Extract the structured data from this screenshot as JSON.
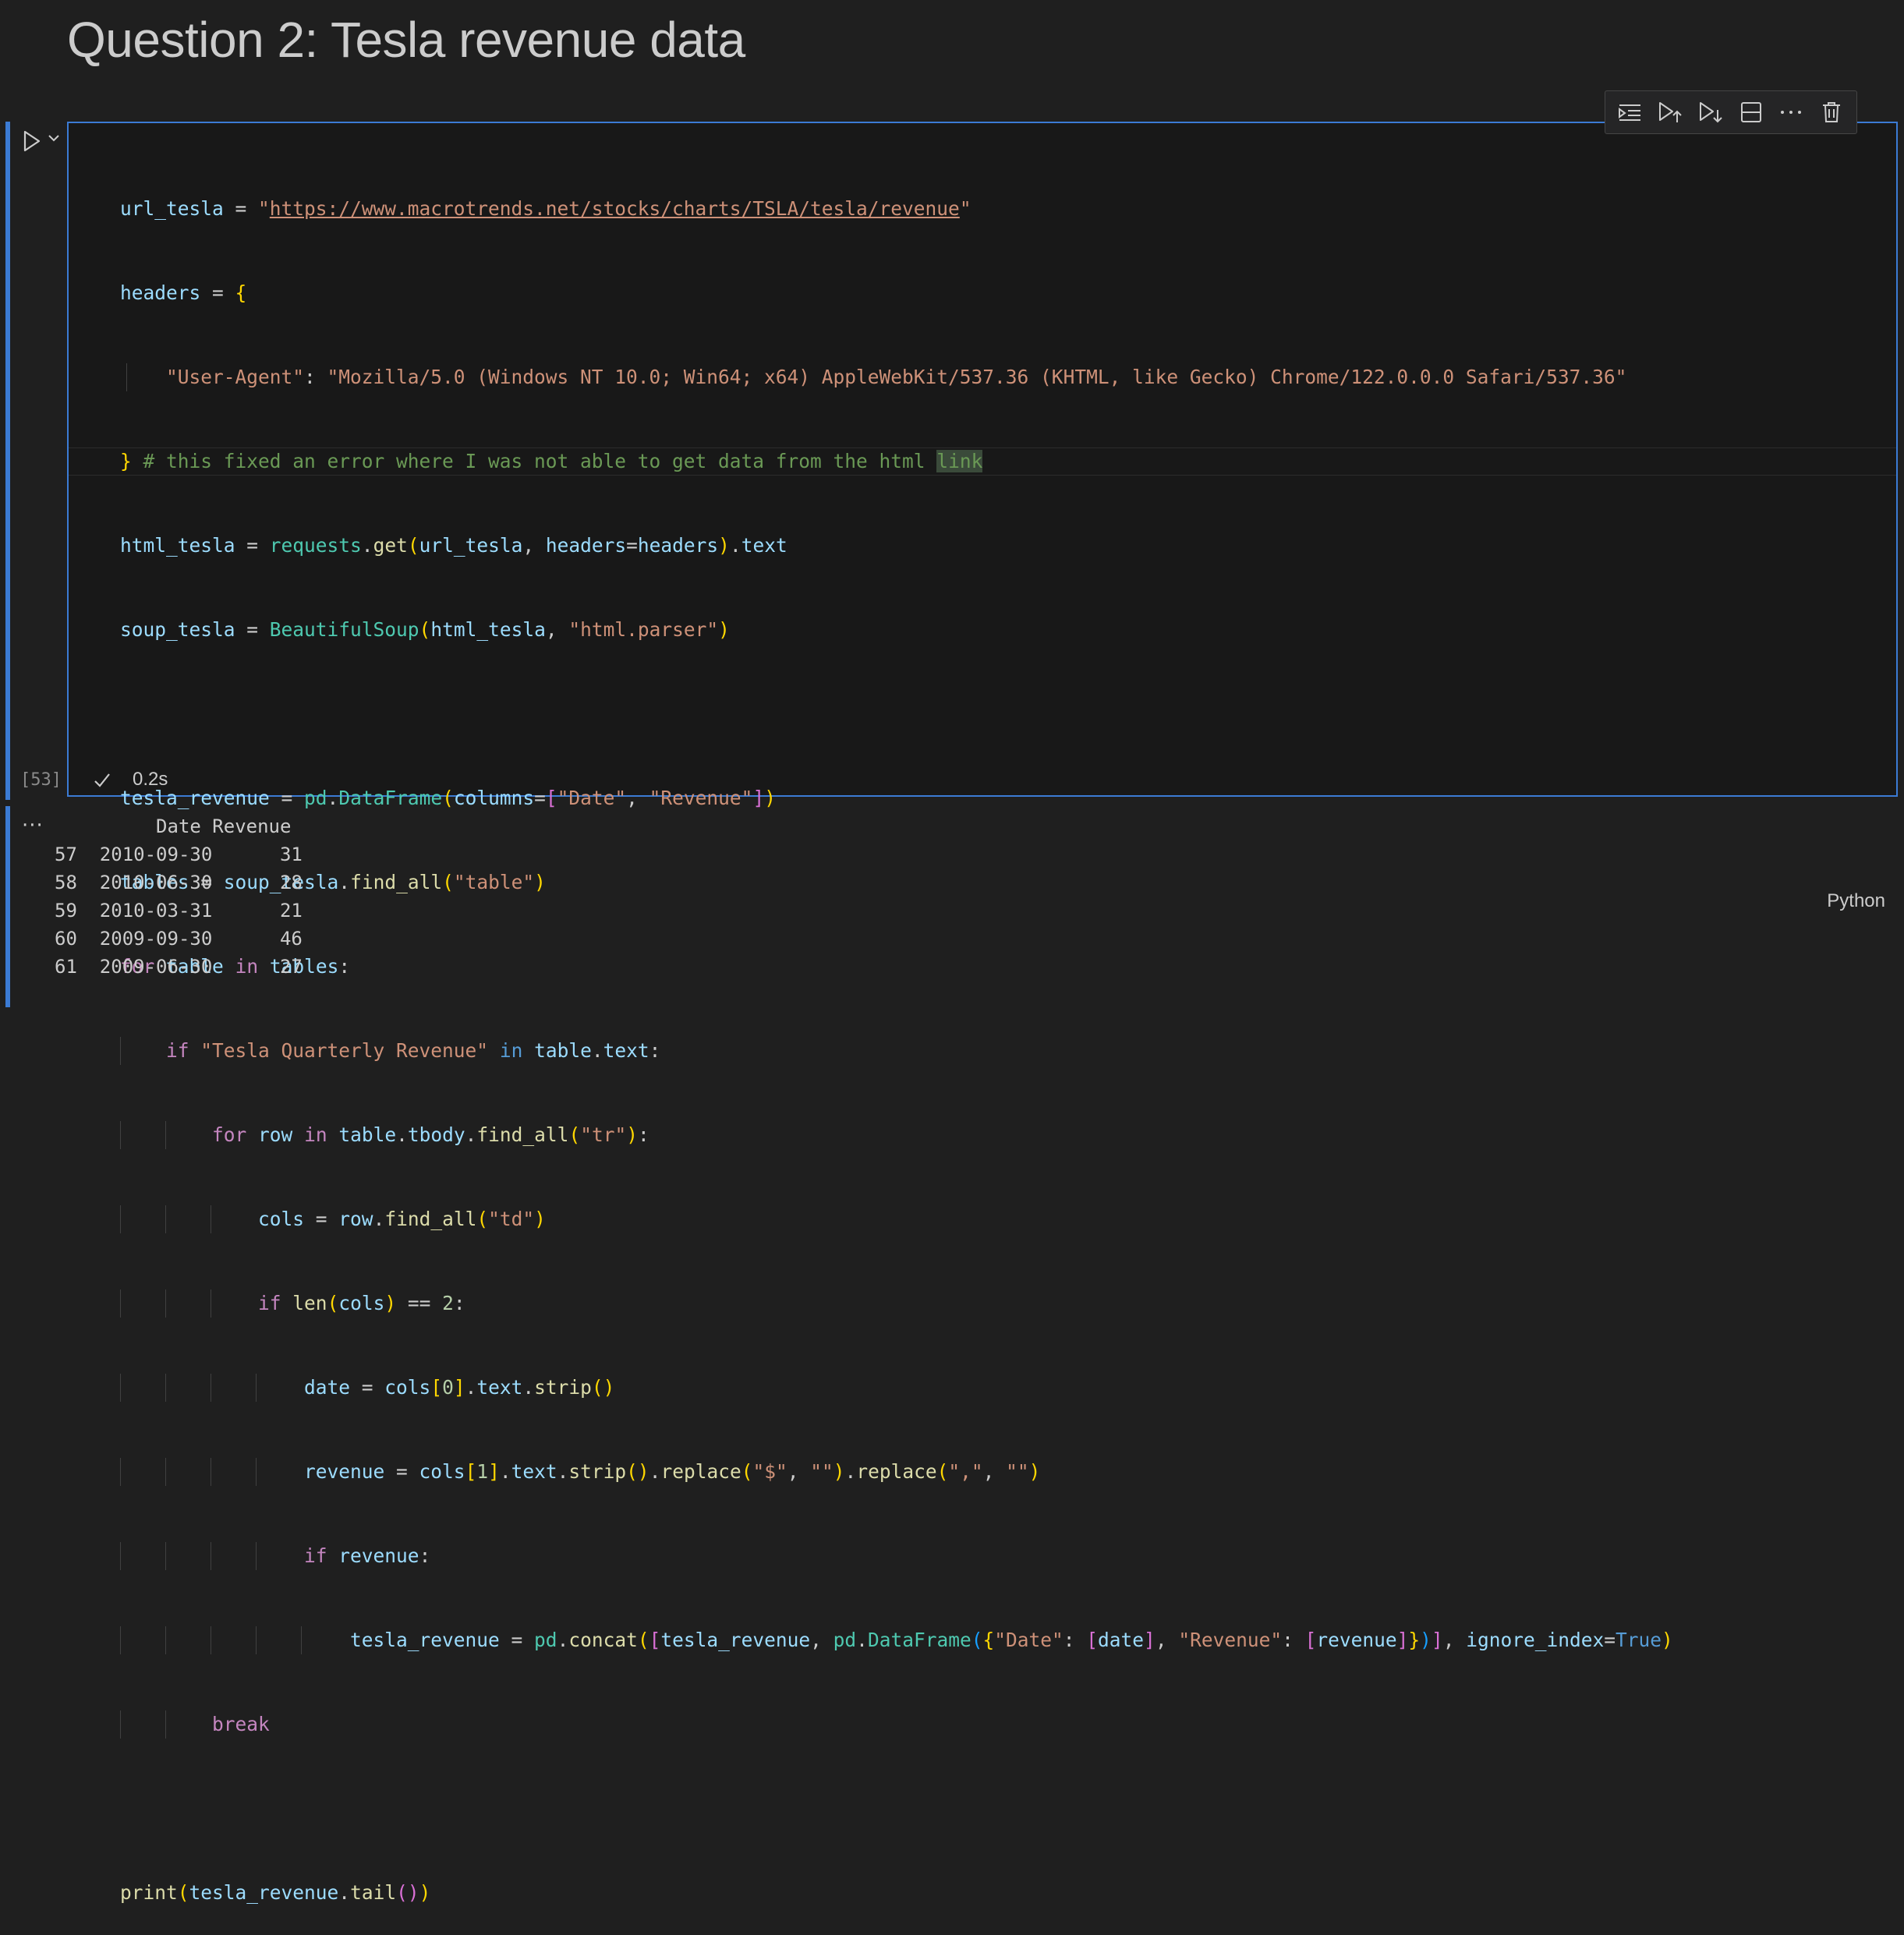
{
  "heading": "Question 2: Tesla revenue data",
  "toolbar": {
    "icons": [
      "execute-above-icon",
      "run-above-icon",
      "run-below-icon",
      "split-cell-icon",
      "more-actions-icon",
      "delete-icon"
    ]
  },
  "cell": {
    "exec_count": "[53]",
    "timing": "0.2s",
    "language": "Python",
    "code": {
      "l1_var": "url_tesla",
      "l1_url": "https://www.macrotrends.net/stocks/charts/TSLA/tesla/revenue",
      "l2_var": "headers",
      "l3_key": "\"User-Agent\"",
      "l3_val": "\"Mozilla/5.0 (Windows NT 10.0; Win64; x64) AppleWebKit/537.36 (KHTML, like Gecko) Chrome/122.0.0.0 Safari/537.36\"",
      "l4_comment": "# this fixed an error where I was not able to get data from the html ",
      "l4_sel": "link",
      "l5_var": "html_tesla",
      "l6_var": "soup_tesla",
      "l8_var": "tesla_revenue",
      "l9_var": "tables",
      "l10_text": "for",
      "l11_str": "\"Tesla Quarterly Revenue\"",
      "l19_text": "tesla_revenue"
    },
    "output_lines": [
      "         Date Revenue",
      "57  2010-09-30      31",
      "58  2010-06-30      28",
      "59  2010-03-31      21",
      "60  2009-09-30      46",
      "61  2009-06-30      27"
    ]
  },
  "colors": {
    "accent": "#3b7bd4",
    "background": "#1f1f1f"
  }
}
